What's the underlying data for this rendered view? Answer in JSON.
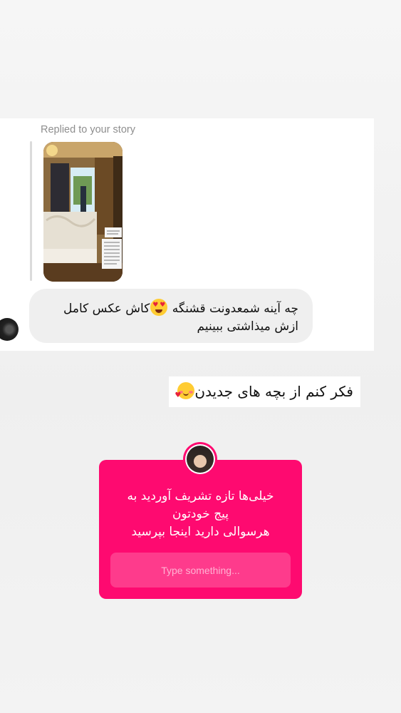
{
  "reply": {
    "label": "Replied to your story",
    "message_line1": "چه آینه شمعدونت قشنگه",
    "message_line1_end": "کاش عکس کامل",
    "message_line2": "ازش میذاشتی ببینیم",
    "emoji": "smiling-face-with-heart-eyes"
  },
  "story_caption": {
    "text": "فکر کنم از بچه های جدیدن",
    "emoji": "smiling-face-with-hearts"
  },
  "question_sticker": {
    "title_line1": "خیلی‌ها تازه تشریف آوردید به",
    "title_line2": "پیج خودتون",
    "title_line3": "هرسوالی دارید اینجا بپرسید",
    "placeholder": "Type something...",
    "color": "#fe0a70"
  }
}
